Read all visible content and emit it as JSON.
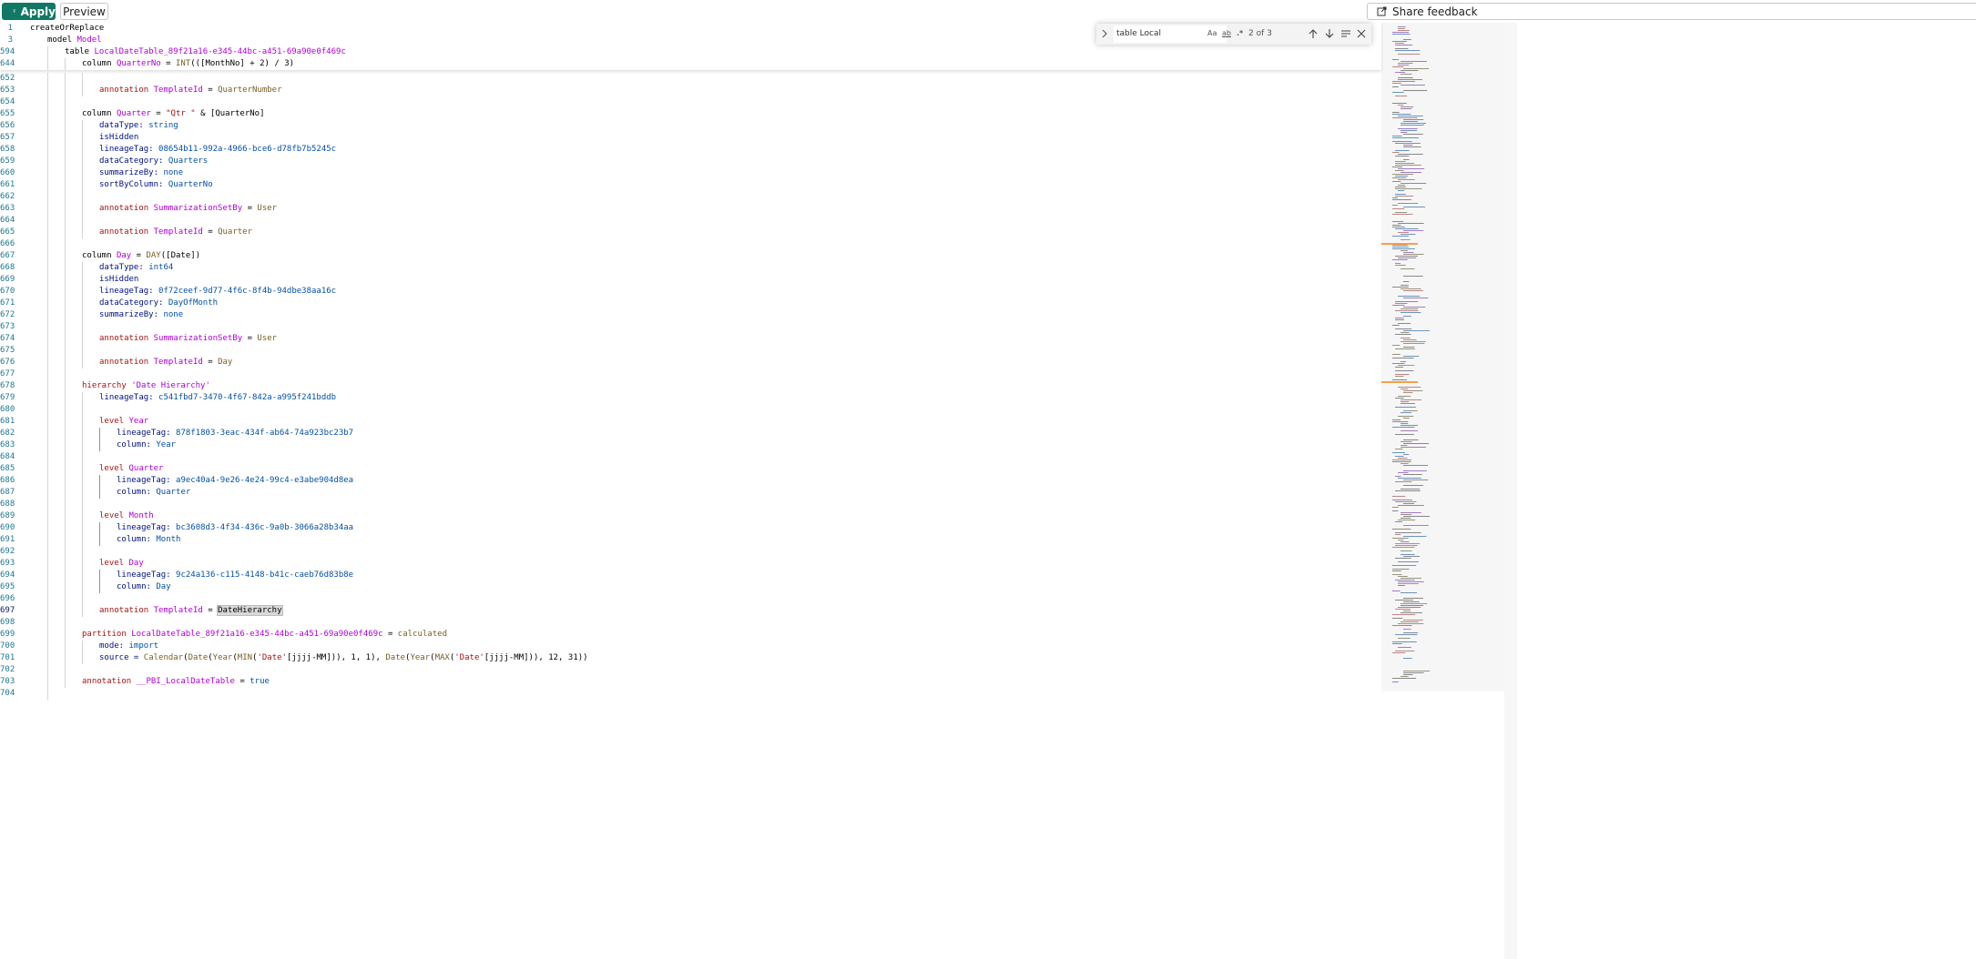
{
  "toolbar": {
    "apply_label": "Apply",
    "preview_label": "Preview",
    "share_label": "Share feedback"
  },
  "find_widget": {
    "query": "table Local",
    "match_case_label": "Aa",
    "whole_word_label": "ab",
    "regex_label": ".*",
    "result_count": "2 of 3"
  },
  "sticky_lines": [
    {
      "num": "1",
      "tokens": [
        [
          "k",
          "createOrReplace"
        ]
      ],
      "indent": 0
    },
    {
      "num": "3",
      "tokens": [
        [
          "k",
          "model "
        ],
        [
          "m",
          "Model"
        ]
      ],
      "indent": 1
    },
    {
      "num": "594",
      "tokens": [
        [
          "k",
          "table "
        ],
        [
          "m",
          "LocalDateTable_89f21a16-e345-44bc-a451-69a90e0f469c"
        ]
      ],
      "indent": 2
    },
    {
      "num": "644",
      "tokens": [
        [
          "k",
          "column "
        ],
        [
          "m",
          "QuarterNo"
        ],
        [
          "k",
          " = "
        ],
        [
          "f",
          "INT"
        ],
        [
          "k",
          "(([MonthNo] + 2) / 3)"
        ]
      ],
      "indent": 3
    }
  ],
  "lines": [
    {
      "num": "652",
      "tokens": [],
      "indent": 4
    },
    {
      "num": "653",
      "tokens": [
        [
          "r",
          "annotation "
        ],
        [
          "m",
          "TemplateId"
        ],
        [
          "k",
          " = "
        ],
        [
          "f",
          "QuarterNumber"
        ]
      ],
      "indent": 4
    },
    {
      "num": "654",
      "tokens": [],
      "indent": 3
    },
    {
      "num": "655",
      "tokens": [
        [
          "k",
          "column "
        ],
        [
          "m",
          "Quarter"
        ],
        [
          "k",
          " = "
        ],
        [
          "s",
          "\"Qtr \""
        ],
        [
          "k",
          " & [QuarterNo]"
        ]
      ],
      "indent": 3
    },
    {
      "num": "656",
      "tokens": [
        [
          "p",
          "dataType: "
        ],
        [
          "v",
          "string"
        ]
      ],
      "indent": 4
    },
    {
      "num": "657",
      "tokens": [
        [
          "p",
          "isHidden"
        ]
      ],
      "indent": 4
    },
    {
      "num": "658",
      "tokens": [
        [
          "p",
          "lineageTag: "
        ],
        [
          "v",
          "08654b11-992a-4966-bce6-d78fb7b5245c"
        ]
      ],
      "indent": 4
    },
    {
      "num": "659",
      "tokens": [
        [
          "p",
          "dataCategory: "
        ],
        [
          "v",
          "Quarters"
        ]
      ],
      "indent": 4
    },
    {
      "num": "660",
      "tokens": [
        [
          "p",
          "summarizeBy: "
        ],
        [
          "v",
          "none"
        ]
      ],
      "indent": 4
    },
    {
      "num": "661",
      "tokens": [
        [
          "p",
          "sortByColumn: "
        ],
        [
          "v",
          "QuarterNo"
        ]
      ],
      "indent": 4
    },
    {
      "num": "662",
      "tokens": [],
      "indent": 4
    },
    {
      "num": "663",
      "tokens": [
        [
          "r",
          "annotation "
        ],
        [
          "m",
          "SummarizationSetBy"
        ],
        [
          "k",
          " = "
        ],
        [
          "f",
          "User"
        ]
      ],
      "indent": 4
    },
    {
      "num": "664",
      "tokens": [],
      "indent": 4
    },
    {
      "num": "665",
      "tokens": [
        [
          "r",
          "annotation "
        ],
        [
          "m",
          "TemplateId"
        ],
        [
          "k",
          " = "
        ],
        [
          "f",
          "Quarter"
        ]
      ],
      "indent": 4
    },
    {
      "num": "666",
      "tokens": [],
      "indent": 3
    },
    {
      "num": "667",
      "tokens": [
        [
          "k",
          "column "
        ],
        [
          "m",
          "Day"
        ],
        [
          "k",
          " = "
        ],
        [
          "f",
          "DAY"
        ],
        [
          "k",
          "([Date])"
        ]
      ],
      "indent": 3
    },
    {
      "num": "668",
      "tokens": [
        [
          "p",
          "dataType: "
        ],
        [
          "v",
          "int64"
        ]
      ],
      "indent": 4
    },
    {
      "num": "669",
      "tokens": [
        [
          "p",
          "isHidden"
        ]
      ],
      "indent": 4
    },
    {
      "num": "670",
      "tokens": [
        [
          "p",
          "lineageTag: "
        ],
        [
          "v",
          "0f72ceef-9d77-4f6c-8f4b-94dbe38aa16c"
        ]
      ],
      "indent": 4
    },
    {
      "num": "671",
      "tokens": [
        [
          "p",
          "dataCategory: "
        ],
        [
          "v",
          "DayOfMonth"
        ]
      ],
      "indent": 4
    },
    {
      "num": "672",
      "tokens": [
        [
          "p",
          "summarizeBy: "
        ],
        [
          "v",
          "none"
        ]
      ],
      "indent": 4
    },
    {
      "num": "673",
      "tokens": [],
      "indent": 4
    },
    {
      "num": "674",
      "tokens": [
        [
          "r",
          "annotation "
        ],
        [
          "m",
          "SummarizationSetBy"
        ],
        [
          "k",
          " = "
        ],
        [
          "f",
          "User"
        ]
      ],
      "indent": 4
    },
    {
      "num": "675",
      "tokens": [],
      "indent": 4
    },
    {
      "num": "676",
      "tokens": [
        [
          "r",
          "annotation "
        ],
        [
          "m",
          "TemplateId"
        ],
        [
          "k",
          " = "
        ],
        [
          "f",
          "Day"
        ]
      ],
      "indent": 4
    },
    {
      "num": "677",
      "tokens": [],
      "indent": 3
    },
    {
      "num": "678",
      "tokens": [
        [
          "r",
          "hierarchy "
        ],
        [
          "m",
          "'Date Hierarchy'"
        ]
      ],
      "indent": 3
    },
    {
      "num": "679",
      "tokens": [
        [
          "p",
          "lineageTag: "
        ],
        [
          "v",
          "c541fbd7-3470-4f67-842a-a995f241bddb"
        ]
      ],
      "indent": 4
    },
    {
      "num": "680",
      "tokens": [],
      "indent": 4
    },
    {
      "num": "681",
      "tokens": [
        [
          "r",
          "level "
        ],
        [
          "m",
          "Year"
        ]
      ],
      "indent": 4
    },
    {
      "num": "682",
      "tokens": [
        [
          "p",
          "lineageTag: "
        ],
        [
          "v",
          "878f1803-3eac-434f-ab64-74a923bc23b7"
        ]
      ],
      "indent": 5
    },
    {
      "num": "683",
      "tokens": [
        [
          "p",
          "column: "
        ],
        [
          "v",
          "Year"
        ]
      ],
      "indent": 5
    },
    {
      "num": "684",
      "tokens": [],
      "indent": 4
    },
    {
      "num": "685",
      "tokens": [
        [
          "r",
          "level "
        ],
        [
          "m",
          "Quarter"
        ]
      ],
      "indent": 4
    },
    {
      "num": "686",
      "tokens": [
        [
          "p",
          "lineageTag: "
        ],
        [
          "v",
          "a9ec40a4-9e26-4e24-99c4-e3abe904d8ea"
        ]
      ],
      "indent": 5
    },
    {
      "num": "687",
      "tokens": [
        [
          "p",
          "column: "
        ],
        [
          "v",
          "Quarter"
        ]
      ],
      "indent": 5
    },
    {
      "num": "688",
      "tokens": [],
      "indent": 4
    },
    {
      "num": "689",
      "tokens": [
        [
          "r",
          "level "
        ],
        [
          "m",
          "Month"
        ]
      ],
      "indent": 4
    },
    {
      "num": "690",
      "tokens": [
        [
          "p",
          "lineageTag: "
        ],
        [
          "v",
          "bc3608d3-4f34-436c-9a0b-3066a28b34aa"
        ]
      ],
      "indent": 5
    },
    {
      "num": "691",
      "tokens": [
        [
          "p",
          "column: "
        ],
        [
          "v",
          "Month"
        ]
      ],
      "indent": 5
    },
    {
      "num": "692",
      "tokens": [],
      "indent": 4
    },
    {
      "num": "693",
      "tokens": [
        [
          "r",
          "level "
        ],
        [
          "m",
          "Day"
        ]
      ],
      "indent": 4
    },
    {
      "num": "694",
      "tokens": [
        [
          "p",
          "lineageTag: "
        ],
        [
          "v",
          "9c24a136-c115-4148-b41c-caeb76d83b8e"
        ]
      ],
      "indent": 5
    },
    {
      "num": "695",
      "tokens": [
        [
          "p",
          "column: "
        ],
        [
          "v",
          "Day"
        ]
      ],
      "indent": 5
    },
    {
      "num": "696",
      "tokens": [],
      "indent": 4
    },
    {
      "num": "697",
      "tokens": [
        [
          "r",
          "annotation "
        ],
        [
          "m",
          "TemplateId"
        ],
        [
          "k",
          " = "
        ],
        [
          "hl",
          "DateHierarchy"
        ]
      ],
      "indent": 4,
      "current": true
    },
    {
      "num": "698",
      "tokens": [],
      "indent": 3
    },
    {
      "num": "699",
      "tokens": [
        [
          "r",
          "partition "
        ],
        [
          "m",
          "LocalDateTable_89f21a16-e345-44bc-a451-69a90e0f469c"
        ],
        [
          "k",
          " = "
        ],
        [
          "f",
          "calculated"
        ]
      ],
      "indent": 3
    },
    {
      "num": "700",
      "tokens": [
        [
          "p",
          "mode: "
        ],
        [
          "v",
          "import"
        ]
      ],
      "indent": 4
    },
    {
      "num": "701",
      "tokens": [
        [
          "p",
          "source = "
        ],
        [
          "f",
          "Calendar"
        ],
        [
          "k",
          "("
        ],
        [
          "f",
          "Date"
        ],
        [
          "k",
          "("
        ],
        [
          "f",
          "Year"
        ],
        [
          "k",
          "("
        ],
        [
          "f",
          "MIN"
        ],
        [
          "k",
          "("
        ],
        [
          "s",
          "'Date'"
        ],
        [
          "k",
          "[jjjj-MM])), 1, 1), "
        ],
        [
          "f",
          "Date"
        ],
        [
          "k",
          "("
        ],
        [
          "f",
          "Year"
        ],
        [
          "k",
          "("
        ],
        [
          "f",
          "MAX"
        ],
        [
          "k",
          "("
        ],
        [
          "s",
          "'Date'"
        ],
        [
          "k",
          "[jjjj-MM])), 12, 31))"
        ]
      ],
      "indent": 4
    },
    {
      "num": "702",
      "tokens": [],
      "indent": 3
    },
    {
      "num": "703",
      "tokens": [
        [
          "r",
          "annotation "
        ],
        [
          "m",
          "__PBI_LocalDateTable"
        ],
        [
          "k",
          " = "
        ],
        [
          "v",
          "true"
        ]
      ],
      "indent": 3
    },
    {
      "num": "704",
      "tokens": [],
      "indent": 2
    }
  ],
  "colors": {
    "apply_bg": "#117865",
    "line_number": "#237893",
    "highlight": "#d9d9d9"
  }
}
